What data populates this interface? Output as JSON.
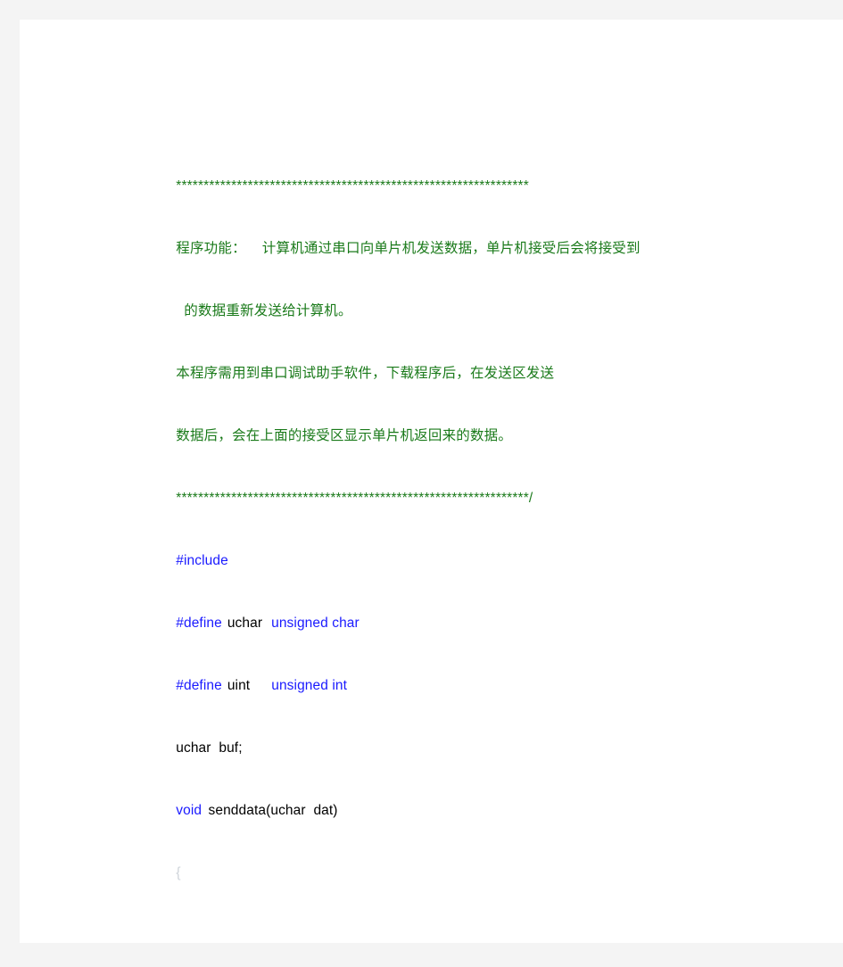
{
  "document": {
    "type": "source-code-listing",
    "language": "C (8051 microcontroller)",
    "colors": {
      "page_background": "#ffffff",
      "viewer_background": "#f4f4f4",
      "comment_green": "#1a7a1a",
      "keyword_blue": "#1a1aff",
      "code_black": "#000000",
      "brace_silver": "#cfd4da"
    },
    "lines": [
      {
        "id": "comment-stars-top",
        "text": "****************************************************************"
      },
      {
        "id": "comment-function-desc-1",
        "text": "程序功能：    计算机通过串口向单片机发送数据，单片机接受后会将接受到"
      },
      {
        "id": "comment-function-desc-2",
        "text": "  的数据重新发送给计算机。"
      },
      {
        "id": "comment-usage-1",
        "text": "本程序需用到串口调试助手软件，下载程序后，在发送区发送"
      },
      {
        "id": "comment-usage-2",
        "text": "数据后，会在上面的接受区显示单片机返回来的数据。"
      },
      {
        "id": "comment-stars-bottom",
        "stars": "****************************************************************",
        "slash": "/"
      },
      {
        "id": "include-directive",
        "directive": "#include"
      },
      {
        "id": "define-uchar",
        "directive": "#define",
        "name": "uchar",
        "value": "unsigned char"
      },
      {
        "id": "define-uint",
        "directive": "#define",
        "name": "uint",
        "value": "unsigned int"
      },
      {
        "id": "declaration-buf",
        "text": "uchar  buf;"
      },
      {
        "id": "function-senddata",
        "keyword": "void",
        "signature": " senddata(uchar  dat)"
      },
      {
        "id": "open-brace",
        "text": "{"
      }
    ]
  }
}
